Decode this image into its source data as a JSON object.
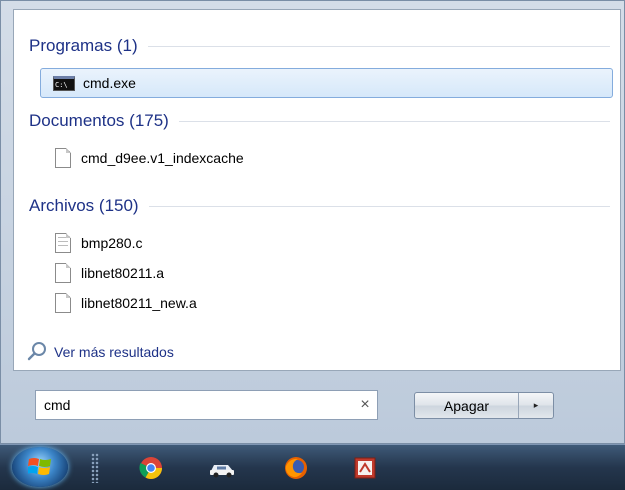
{
  "groups": {
    "programs": {
      "title": "Programas (1)",
      "items": [
        {
          "label": "cmd.exe",
          "icon": "console-icon",
          "selected": true
        }
      ]
    },
    "documents": {
      "title": "Documentos (175)",
      "items": [
        {
          "label": "cmd_d9ee.v1_indexcache",
          "icon": "document-icon"
        }
      ]
    },
    "files": {
      "title": "Archivos (150)",
      "items": [
        {
          "label": "bmp280.c",
          "icon": "text-file-icon"
        },
        {
          "label": "libnet80211.a",
          "icon": "document-icon"
        },
        {
          "label": "libnet80211_new.a",
          "icon": "document-icon"
        }
      ]
    }
  },
  "more_results": {
    "label": "Ver más resultados",
    "icon": "search-icon"
  },
  "search": {
    "value": "cmd",
    "clear_glyph": "×"
  },
  "shutdown": {
    "label": "Apagar",
    "arrow_glyph": "▸"
  },
  "cmd_icon_text": "C:\\",
  "taskbar": {
    "apps": [
      "chrome-icon",
      "car-app-icon",
      "firefox-icon",
      "paint-app-icon"
    ]
  },
  "colors": {
    "group_title": "#1e3287",
    "selection_border": "#84acdd",
    "taskbar": "#24364d"
  }
}
